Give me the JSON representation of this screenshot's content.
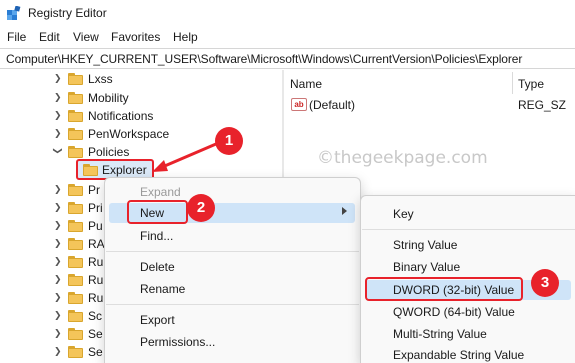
{
  "window": {
    "title": "Registry Editor",
    "icon": "registry-editor-icon"
  },
  "menubar": [
    "File",
    "Edit",
    "View",
    "Favorites",
    "Help"
  ],
  "address_path": "Computer\\HKEY_CURRENT_USER\\Software\\Microsoft\\Windows\\CurrentVersion\\Policies\\Explorer",
  "tree": {
    "items": [
      {
        "label": "Lxss",
        "expanded": false
      },
      {
        "label": "Mobility",
        "expanded": false
      },
      {
        "label": "Notifications",
        "expanded": false
      },
      {
        "label": "PenWorkspace",
        "expanded": false
      },
      {
        "label": "Policies",
        "expanded": true
      },
      {
        "label": "Explorer",
        "selected": true
      },
      {
        "label": "Pr"
      },
      {
        "label": "Pri"
      },
      {
        "label": "Pu"
      },
      {
        "label": "RA"
      },
      {
        "label": "Ru"
      },
      {
        "label": "Ru"
      },
      {
        "label": "Ru"
      },
      {
        "label": "Sc"
      },
      {
        "label": "Se"
      },
      {
        "label": "Se"
      }
    ]
  },
  "values_pane": {
    "columns": {
      "name": "Name",
      "type": "Type"
    },
    "rows": [
      {
        "name": "(Default)",
        "type": "REG_SZ",
        "icon": "string-value-icon"
      }
    ]
  },
  "watermark": "©thegeekpage.com",
  "context_menu": {
    "expand": "Expand",
    "new": "New",
    "find": "Find...",
    "delete": "Delete",
    "rename": "Rename",
    "export": "Export",
    "permissions": "Permissions..."
  },
  "submenu": {
    "key": "Key",
    "string_value": "String Value",
    "binary_value": "Binary Value",
    "dword_value": "DWORD (32-bit) Value",
    "qword_value": "QWORD (64-bit) Value",
    "multi_string_value": "Multi-String Value",
    "expandable_string_value": "Expandable String Value"
  },
  "annotations": {
    "step1": "1",
    "step2": "2",
    "step3": "3"
  },
  "colors": {
    "annotation_red": "#e8222b",
    "highlight": "#cfe4f8",
    "folder": "#f4c55a"
  }
}
